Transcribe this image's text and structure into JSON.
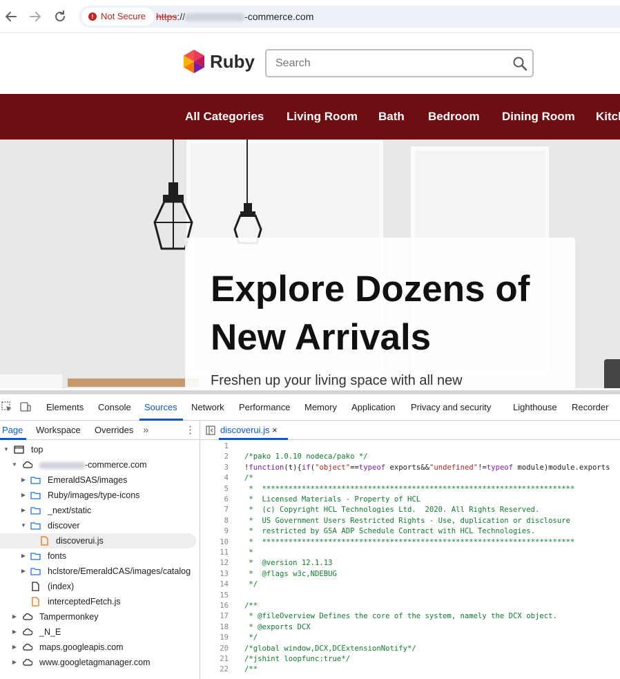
{
  "browser": {
    "back_icon": "back-arrow-icon",
    "forward_icon": "forward-arrow-icon",
    "reload_icon": "reload-icon",
    "security_label": "Not Secure",
    "url_scheme": "https",
    "url_sep": "://",
    "url_suffix": "-commerce.com"
  },
  "site": {
    "logo_text": "Ruby",
    "search_placeholder": "Search",
    "categories": [
      "All Categories",
      "Living Room",
      "Bath",
      "Bedroom",
      "Dining Room",
      "Kitchen"
    ]
  },
  "hero": {
    "title": "Explore Dozens of New Arrivals",
    "subtitle": "Freshen up your living space with all new"
  },
  "devtools": {
    "tabs": [
      "Elements",
      "Console",
      "Sources",
      "Network",
      "Performance",
      "Memory",
      "Application",
      "Privacy and security",
      "Lighthouse",
      "Recorder"
    ],
    "active_tab": "Sources",
    "nav_tabs": [
      "Page",
      "Workspace",
      "Overrides"
    ],
    "more_label": "»",
    "menu_label": "⋮",
    "open_file": "discoverui.js",
    "close_label": "×",
    "tree": [
      {
        "label": "top",
        "type": "frame"
      },
      {
        "label": "-commerce.com",
        "type": "cloud",
        "blurred_prefix": true
      },
      {
        "label": "EmeraldSAS/images",
        "type": "folder"
      },
      {
        "label": "Ruby/images/type-icons",
        "type": "folder"
      },
      {
        "label": "_next/static",
        "type": "folder"
      },
      {
        "label": "discover",
        "type": "folder"
      },
      {
        "label": "discoverui.js",
        "type": "js"
      },
      {
        "label": "fonts",
        "type": "folder"
      },
      {
        "label": "hclstore/EmeraldCAS/images/catalog",
        "type": "folder"
      },
      {
        "label": "(index)",
        "type": "doc"
      },
      {
        "label": "interceptedFetch.js",
        "type": "js"
      },
      {
        "label": "Tampermonkey",
        "type": "cloud"
      },
      {
        "label": "_N_E",
        "type": "cloud"
      },
      {
        "label": "maps.googleapis.com",
        "type": "cloud"
      },
      {
        "label": "www.googletagmanager.com",
        "type": "cloud"
      }
    ],
    "code_lines": [
      {
        "n": "1",
        "t": ""
      },
      {
        "n": "2",
        "t": "/*pako 1.0.10 nodeca/pako */"
      },
      {
        "n": "3",
        "t": "!function(t){if(\"object\"==typeof exports&&\"undefined\"!=typeof module)module.exports"
      },
      {
        "n": "4",
        "t": "/*"
      },
      {
        "n": "5",
        "t": " *  ***********************************************************************"
      },
      {
        "n": "6",
        "t": " *  Licensed Materials - Property of HCL"
      },
      {
        "n": "7",
        "t": " *  (c) Copyright HCL Technologies Ltd.  2020. All Rights Reserved."
      },
      {
        "n": "8",
        "t": " *  US Government Users Restricted Rights - Use, duplication or disclosure"
      },
      {
        "n": "9",
        "t": " *  restricted by GSA ADP Schedule Contract with HCL Technologies."
      },
      {
        "n": "10",
        "t": " *  ***********************************************************************"
      },
      {
        "n": "11",
        "t": " *"
      },
      {
        "n": "12",
        "t": " *  @version 12.1.13"
      },
      {
        "n": "13",
        "t": " *  @flags w3c,NDEBUG"
      },
      {
        "n": "14",
        "t": " */"
      },
      {
        "n": "15",
        "t": ""
      },
      {
        "n": "16",
        "t": "/**"
      },
      {
        "n": "17",
        "t": " * @fileOverview Defines the core of the system, namely the DCX object."
      },
      {
        "n": "18",
        "t": " * @exports DCX"
      },
      {
        "n": "19",
        "t": " */"
      },
      {
        "n": "20",
        "t": "/*global window,DCX,DCExtensionNotify*/"
      },
      {
        "n": "21",
        "t": "/*jshint loopfunc:true*/"
      },
      {
        "n": "22",
        "t": "/**"
      }
    ]
  },
  "colors": {
    "nav_bg": "#6e0d12",
    "accent": "#0b57d0",
    "comment": "#0d7c2c",
    "string": "#b3261e"
  }
}
